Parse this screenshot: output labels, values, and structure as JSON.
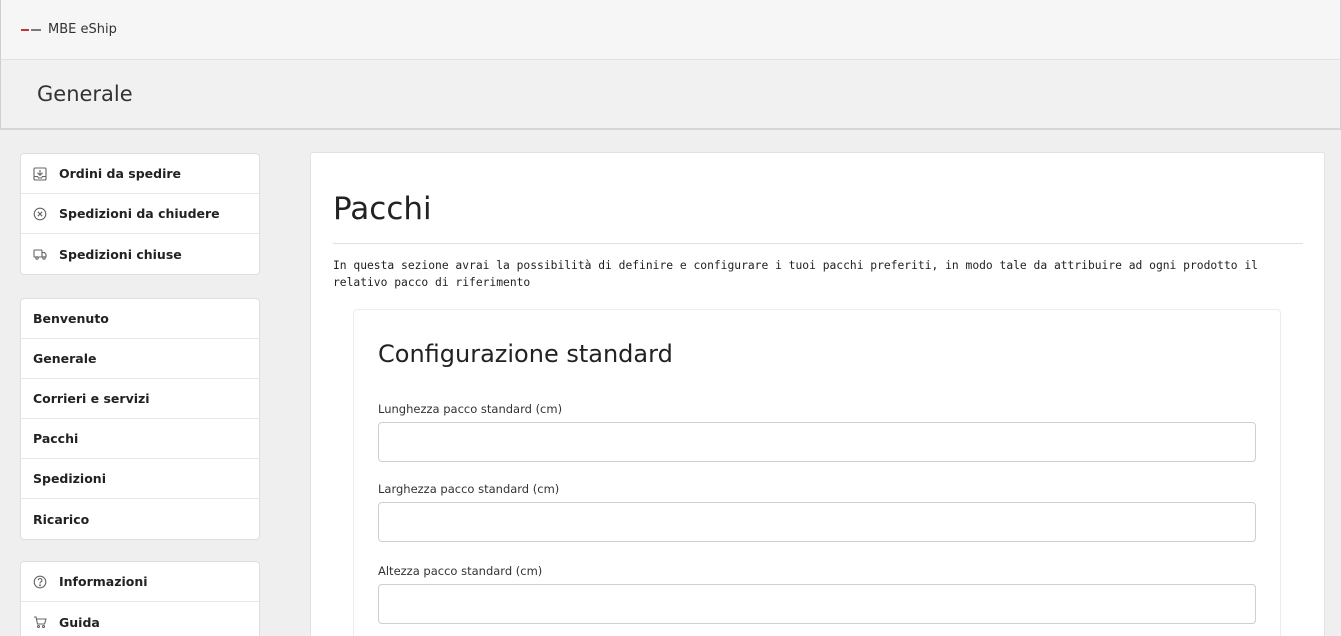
{
  "app": {
    "title": "MBE eShip"
  },
  "header": {
    "title": "Generale"
  },
  "sidebar": {
    "shipments": [
      {
        "icon": "inbox-download-icon",
        "label": "Ordini da spedire"
      },
      {
        "icon": "circle-x-icon",
        "label": "Spedizioni da chiudere"
      },
      {
        "icon": "truck-icon",
        "label": "Spedizioni chiuse"
      }
    ],
    "settings": [
      {
        "label": "Benvenuto"
      },
      {
        "label": "Generale"
      },
      {
        "label": "Corrieri e servizi"
      },
      {
        "label": "Pacchi"
      },
      {
        "label": "Spedizioni"
      },
      {
        "label": "Ricarico"
      }
    ],
    "help": [
      {
        "icon": "info-circle-icon",
        "label": "Informazioni"
      },
      {
        "icon": "guide-icon",
        "label": "Guida"
      }
    ]
  },
  "main": {
    "title": "Pacchi",
    "intro": "In questa sezione avrai la possibilità di definire e configurare i tuoi pacchi preferiti, in modo tale da attribuire ad ogni prodotto il relativo pacco di riferimento",
    "card": {
      "title": "Configurazione standard",
      "fields": [
        {
          "label": "Lunghezza pacco standard (cm)",
          "value": "",
          "placeholder": ""
        },
        {
          "label": "Larghezza pacco standard (cm)",
          "value": "",
          "placeholder": ""
        },
        {
          "label": "Altezza pacco standard (cm)",
          "value": "",
          "placeholder": ""
        }
      ]
    }
  },
  "colors": {
    "accent": "#c0392b",
    "background": "#efefef",
    "panel": "#ffffff"
  }
}
